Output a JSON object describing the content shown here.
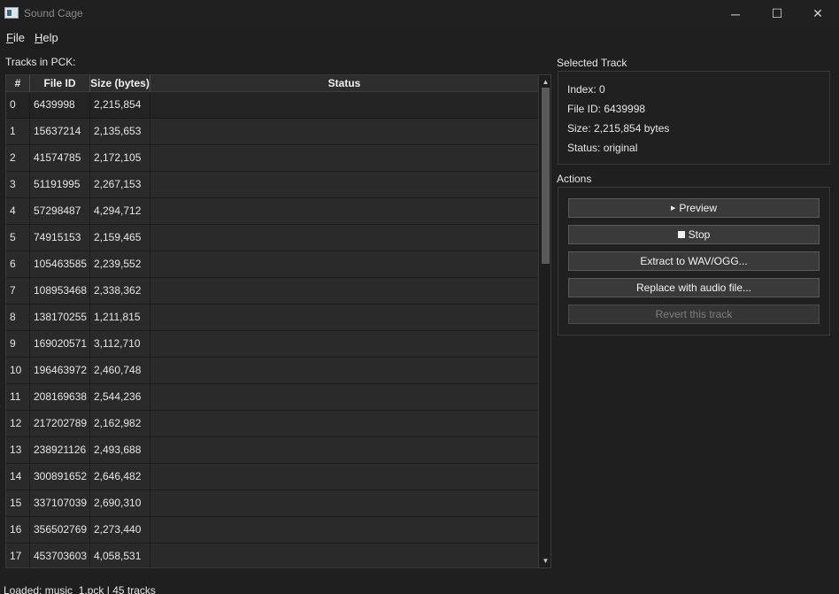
{
  "window": {
    "title": "Sound Cage",
    "minimize_glyph": "─",
    "maximize_glyph": "☐",
    "close_glyph": "✕"
  },
  "menu": {
    "file": {
      "u": "F",
      "rest": "ile"
    },
    "help": {
      "u": "H",
      "rest": "elp"
    }
  },
  "tracks_label": "Tracks in PCK:",
  "table": {
    "headers": [
      "#",
      "File ID",
      "Size (bytes)",
      "Status"
    ],
    "rows": [
      {
        "idx": "0",
        "file_id": "6439998",
        "size": "2,215,854",
        "status": ""
      },
      {
        "idx": "1",
        "file_id": "15637214",
        "size": "2,135,653",
        "status": ""
      },
      {
        "idx": "2",
        "file_id": "41574785",
        "size": "2,172,105",
        "status": ""
      },
      {
        "idx": "3",
        "file_id": "51191995",
        "size": "2,267,153",
        "status": ""
      },
      {
        "idx": "4",
        "file_id": "57298487",
        "size": "4,294,712",
        "status": ""
      },
      {
        "idx": "5",
        "file_id": "74915153",
        "size": "2,159,465",
        "status": ""
      },
      {
        "idx": "6",
        "file_id": "105463585",
        "size": "2,239,552",
        "status": ""
      },
      {
        "idx": "7",
        "file_id": "108953468",
        "size": "2,338,362",
        "status": ""
      },
      {
        "idx": "8",
        "file_id": "138170255",
        "size": "1,211,815",
        "status": ""
      },
      {
        "idx": "9",
        "file_id": "169020571",
        "size": "3,112,710",
        "status": ""
      },
      {
        "idx": "10",
        "file_id": "196463972",
        "size": "2,460,748",
        "status": ""
      },
      {
        "idx": "11",
        "file_id": "208169638",
        "size": "2,544,236",
        "status": ""
      },
      {
        "idx": "12",
        "file_id": "217202789",
        "size": "2,162,982",
        "status": ""
      },
      {
        "idx": "13",
        "file_id": "238921126",
        "size": "2,493,688",
        "status": ""
      },
      {
        "idx": "14",
        "file_id": "300891652",
        "size": "2,646,482",
        "status": ""
      },
      {
        "idx": "15",
        "file_id": "337107039",
        "size": "2,690,310",
        "status": ""
      },
      {
        "idx": "16",
        "file_id": "356502769",
        "size": "2,273,440",
        "status": ""
      },
      {
        "idx": "17",
        "file_id": "453703603",
        "size": "4,058,531",
        "status": ""
      }
    ]
  },
  "selected_track": {
    "title": "Selected Track",
    "index": "Index: 0",
    "file_id": "File ID: 6439998",
    "size": "Size: 2,215,854 bytes",
    "status": "Status: original"
  },
  "actions": {
    "title": "Actions",
    "preview": "Preview",
    "stop": "Stop",
    "extract": "Extract to WAV/OGG...",
    "replace": "Replace with audio file...",
    "revert": "Revert this track"
  },
  "statusbar": "Loaded: music_1.pck | 45 tracks"
}
